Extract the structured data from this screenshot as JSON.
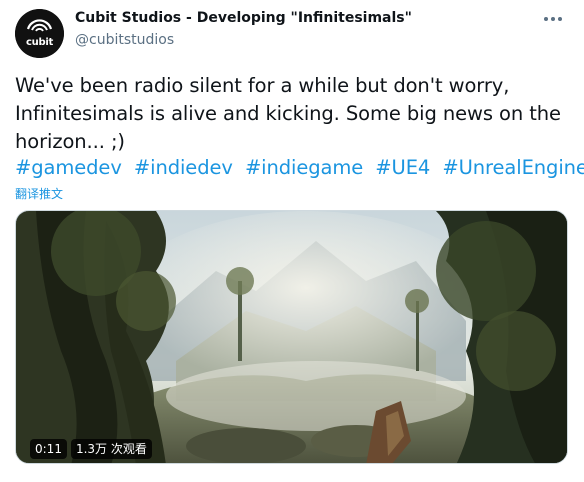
{
  "account": {
    "display_name": "Cubit Studios - Developing \"Infinitesimals\"",
    "handle": "@cubitstudios",
    "avatar_text": "cubit"
  },
  "tweet": {
    "text_lines": [
      "We've been radio silent for a while but don't worry,",
      "Infinitesimals is alive and kicking. Some big news on the",
      "horizon... ;)"
    ],
    "hashtags": [
      "#gamedev",
      "#indiedev",
      "#indiegame",
      "#UE4",
      "#UnrealEngine"
    ],
    "translate_label": "翻译推文"
  },
  "video": {
    "duration": "0:11",
    "views": "1.3万 次观看"
  },
  "icons": {
    "more": "more-horizontal-icon",
    "avatar_logo": "cubit-logo-icon"
  },
  "colors": {
    "link": "#1b95e0",
    "text": "#0f1419",
    "secondary": "#5b7083"
  }
}
